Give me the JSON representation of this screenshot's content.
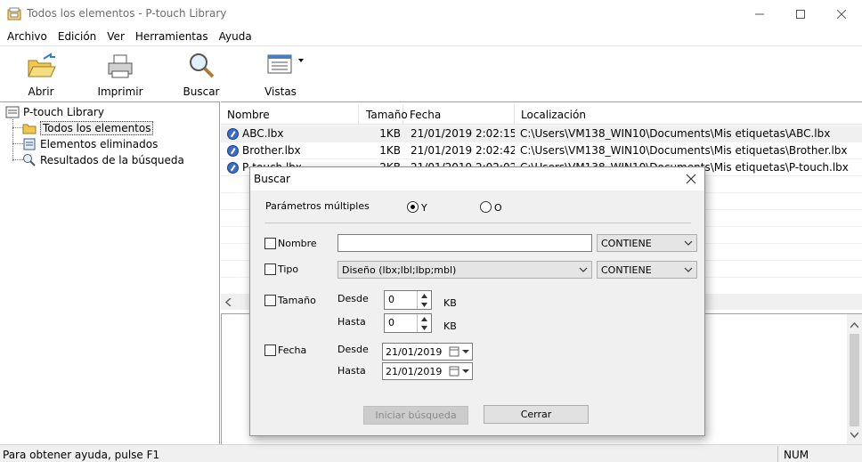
{
  "window": {
    "title": "Todos los elementos - P-touch Library"
  },
  "menu": [
    "Archivo",
    "Edición",
    "Ver",
    "Herramientas",
    "Ayuda"
  ],
  "toolbar": {
    "open": "Abrir",
    "print": "Imprimir",
    "search": "Buscar",
    "views": "Vistas"
  },
  "tree": {
    "root": "P-touch Library",
    "items": [
      "Todos los elementos",
      "Elementos eliminados",
      "Resultados de la búsqueda"
    ]
  },
  "list": {
    "columns": [
      "Nombre",
      "Tamaño",
      "Fecha",
      "Localización"
    ],
    "rows": [
      {
        "name": "ABC.lbx",
        "size": "1KB",
        "date": "21/01/2019 2:02:15",
        "location": "C:\\Users\\VM138_WIN10\\Documents\\Mis etiquetas\\ABC.lbx"
      },
      {
        "name": "Brother.lbx",
        "size": "1KB",
        "date": "21/01/2019 2:02:42",
        "location": "C:\\Users\\VM138_WIN10\\Documents\\Mis etiquetas\\Brother.lbx"
      },
      {
        "name": "P-touch.lbx",
        "size": "2KB",
        "date": "21/01/2019 2:02:02",
        "location": "C:\\Users\\VM138_WIN10\\Documents\\Mis etiquetas\\P-touch.lbx"
      }
    ]
  },
  "status": {
    "help": "Para obtener ayuda, pulse F1",
    "num": "NUM"
  },
  "dialog": {
    "title": "Buscar",
    "multi_params_label": "Parámetros múltiples",
    "radio_and": "Y",
    "radio_or": "O",
    "name_label": "Nombre",
    "name_value": "",
    "name_condition": "CONTIENE",
    "type_label": "Tipo",
    "type_value": "Diseño (lbx;lbl;lbp;mbl)",
    "type_condition": "CONTIENE",
    "size_label": "Tamaño",
    "from_label": "Desde",
    "to_label": "Hasta",
    "size_from": "0",
    "size_to": "0",
    "size_unit": "KB",
    "date_label": "Fecha",
    "date_from": "21/01/2019",
    "date_to": "21/01/2019",
    "start_button": "Iniciar búsqueda",
    "close_button": "Cerrar"
  }
}
